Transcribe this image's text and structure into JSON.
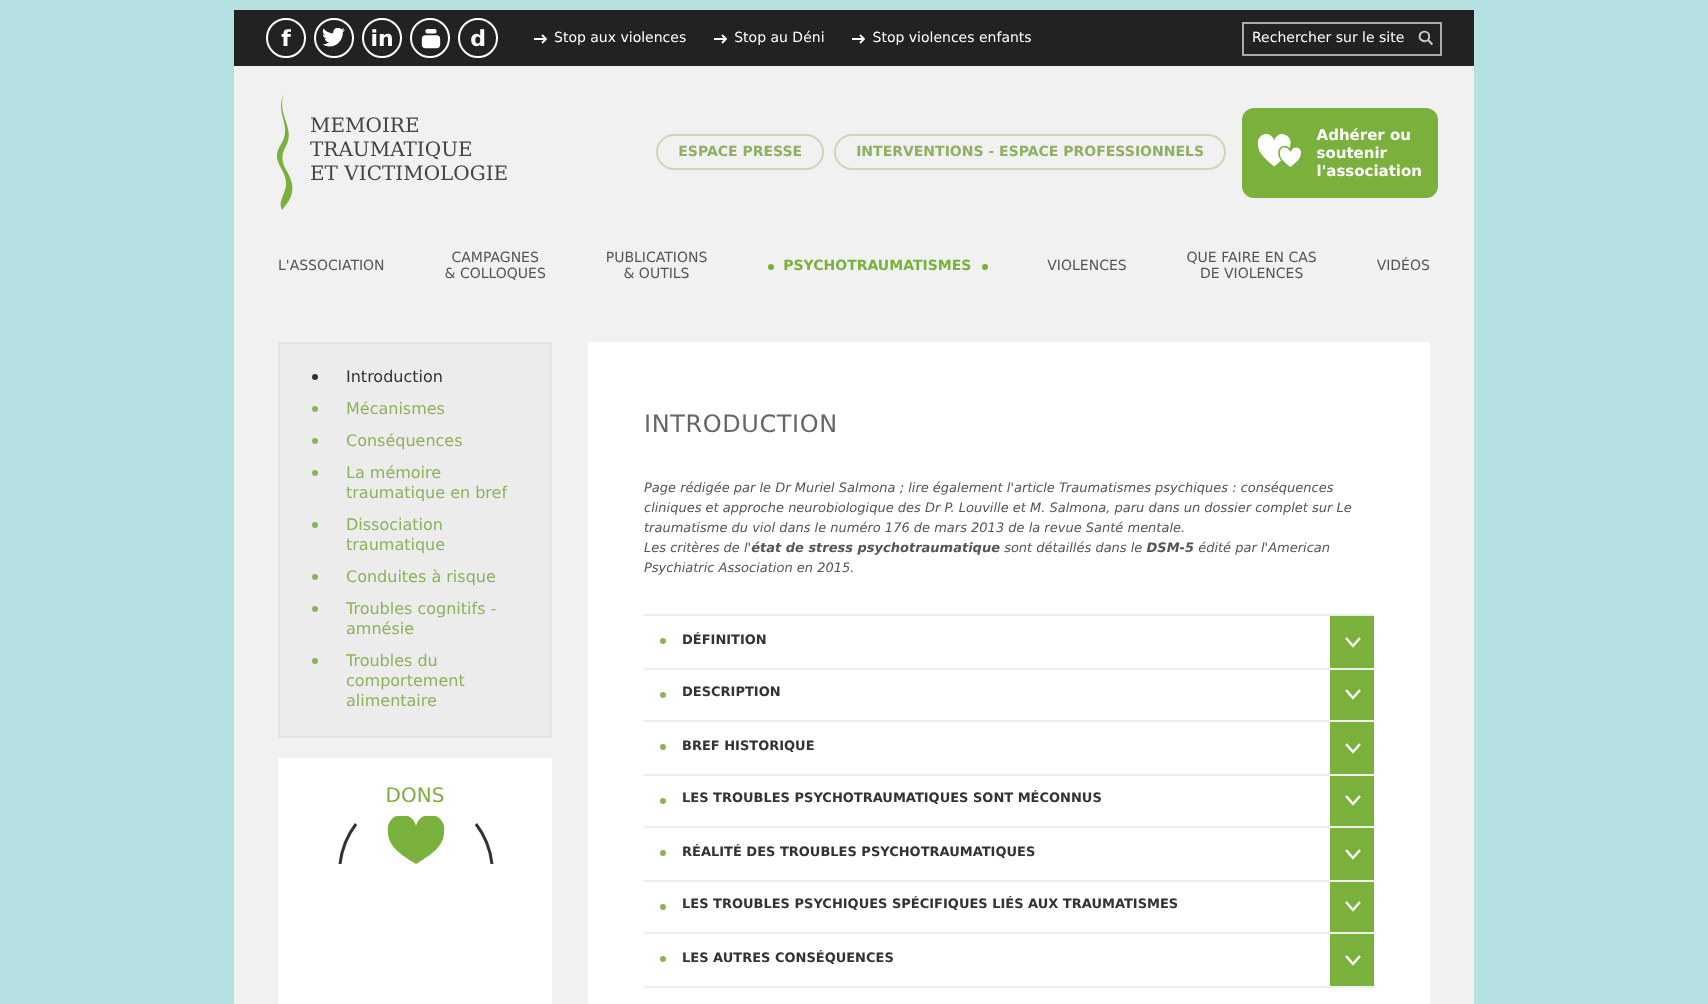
{
  "topbar": {
    "socials": [
      {
        "kind": "letter",
        "label": "f"
      },
      {
        "kind": "bird"
      },
      {
        "kind": "letter",
        "label": "in"
      },
      {
        "kind": "tube"
      },
      {
        "kind": "letter",
        "label": "d"
      }
    ],
    "links": [
      "Stop aux violences",
      "Stop au Déni",
      "Stop violences enfants"
    ],
    "search": {
      "placeholder": "Rechercher sur le site"
    }
  },
  "logo": {
    "lines": [
      "MEMOIRE",
      "TRAUMATIQUE",
      "ET VICTIMOLOGIE"
    ]
  },
  "header_buttons": [
    "ESPACE PRESSE",
    "INTERVENTIONS - ESPACE PROFESSIONNELS"
  ],
  "join_button": {
    "lines": [
      "Adhérer ou",
      "soutenir",
      "l'association"
    ]
  },
  "nav": [
    {
      "lines": [
        "L'ASSOCIATION"
      ],
      "selected": false
    },
    {
      "lines": [
        "CAMPAGNES",
        "& COLLOQUES"
      ],
      "selected": false
    },
    {
      "lines": [
        "PUBLICATIONS",
        "& OUTILS"
      ],
      "selected": false
    },
    {
      "lines": [
        "PSYCHOTRAUMATISMES"
      ],
      "selected": true
    },
    {
      "lines": [
        "VIOLENCES"
      ],
      "selected": false
    },
    {
      "lines": [
        "QUE FAIRE EN CAS",
        "DE VIOLENCES"
      ],
      "selected": false
    },
    {
      "lines": [
        "VIDÉOS"
      ],
      "selected": false
    }
  ],
  "sidebar": {
    "items": [
      {
        "label": "Introduction",
        "selected": true
      },
      {
        "label": "Mécanismes",
        "selected": false
      },
      {
        "label": "Conséquences",
        "selected": false
      },
      {
        "label": "La mémoire traumatique en bref",
        "selected": false
      },
      {
        "label": "Dissociation traumatique",
        "selected": false
      },
      {
        "label": "Conduites à risque",
        "selected": false
      },
      {
        "label": "Troubles cognitifs - amnésie",
        "selected": false
      },
      {
        "label": "Troubles du comportement alimentaire",
        "selected": false
      }
    ]
  },
  "dons": {
    "title": "DONS"
  },
  "main": {
    "title": "INTRODUCTION",
    "paragraphs": [
      "Page rédigée par le Dr Muriel Salmona ; lire également l'article Traumatismes psychiques : conséquences cliniques et approche neurobiologique des Dr P. Louville et M. Salmona, paru dans un dossier complet sur Le traumatisme du viol dans le numéro 176 de mars 2013 de la revue Santé mentale.",
      "Les critères de l'**état de stress psychotraumatique** sont détaillés dans le **DSM-5** édité par l'American Psychiatric Association en 2015."
    ],
    "accordion": [
      {
        "label": "DÉFINITION",
        "expanded": false
      },
      {
        "label": "DESCRIPTION",
        "expanded": false
      },
      {
        "label": "BREF HISTORIQUE",
        "expanded": false
      },
      {
        "label": "LES TROUBLES PSYCHOTRAUMATIQUES SONT MÉCONNUS",
        "expanded": false
      },
      {
        "label": "RÉALITÉ DES TROUBLES PSYCHOTRAUMATIQUES",
        "expanded": false
      },
      {
        "label": "LES TROUBLES PSYCHIQUES SPÉCIFIQUES LIÉS AUX TRAUMATISMES",
        "expanded": false
      },
      {
        "label": "LES AUTRES CONSÉQUENCES",
        "expanded": false
      }
    ]
  }
}
